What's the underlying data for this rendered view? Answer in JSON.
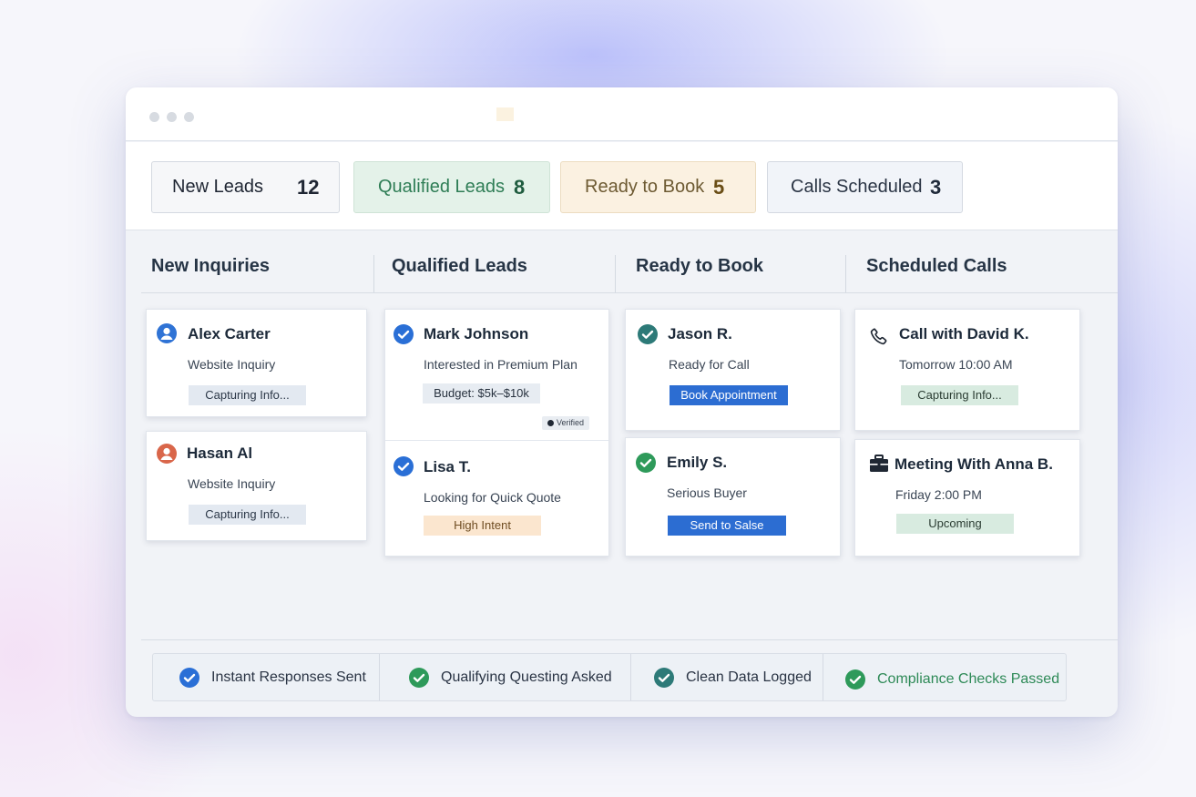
{
  "stats": [
    {
      "label": "New Leads",
      "count": "12"
    },
    {
      "label": "Qualified Leads",
      "count": "8"
    },
    {
      "label": "Ready to Book",
      "count": "5"
    },
    {
      "label": "Calls Scheduled",
      "count": "3"
    }
  ],
  "columns": {
    "new": {
      "title": "New Inquiries",
      "cards": [
        {
          "name": "Alex Carter",
          "sub": "Website Inquiry",
          "tag": "Capturing Info...",
          "icon": "user-avatar-icon"
        },
        {
          "name": "Hasan Al",
          "sub": "Website Inquiry",
          "tag": "Capturing Info...",
          "icon": "user-avatar-icon"
        }
      ]
    },
    "qualified": {
      "title": "Qualified Leads",
      "cards": [
        {
          "name": "Mark Johnson",
          "sub": "Interested in Premium Plan",
          "tag": "Budget: $5k–$10k",
          "badge": "Verified",
          "icon": "check-circle-icon"
        },
        {
          "name": "Lisa T.",
          "sub": "Looking for Quick Quote",
          "tag": "High Intent",
          "icon": "check-circle-icon"
        }
      ]
    },
    "ready": {
      "title": "Ready to Book",
      "cards": [
        {
          "name": "Jason R.",
          "sub": "Ready for Call",
          "action": "Book Appointment",
          "icon": "check-circle-icon"
        },
        {
          "name": "Emily S.",
          "sub": "Serious Buyer",
          "action": "Send to Salse",
          "icon": "check-circle-icon"
        }
      ]
    },
    "scheduled": {
      "title": "Scheduled Calls",
      "cards": [
        {
          "name": "Call with David K.",
          "sub": "Tomorrow 10:00 AM",
          "tag": "Capturing Info...",
          "icon": "phone-icon"
        },
        {
          "name": "Meeting With Anna B.",
          "sub": "Friday 2:00 PM",
          "tag": "Upcoming",
          "icon": "briefcase-icon"
        }
      ]
    }
  },
  "footer": [
    {
      "label": "Instant Responses Sent"
    },
    {
      "label": "Qualifying Questing Asked"
    },
    {
      "label": "Clean Data Logged"
    },
    {
      "label": "Compliance Checks Passed"
    }
  ],
  "colors": {
    "accent_blue": "#2c6dd2",
    "check_blue": "#2a6fd6",
    "check_teal": "#2d7a78",
    "check_green": "#2e9a5a",
    "compliance_text": "#2e8a57"
  }
}
